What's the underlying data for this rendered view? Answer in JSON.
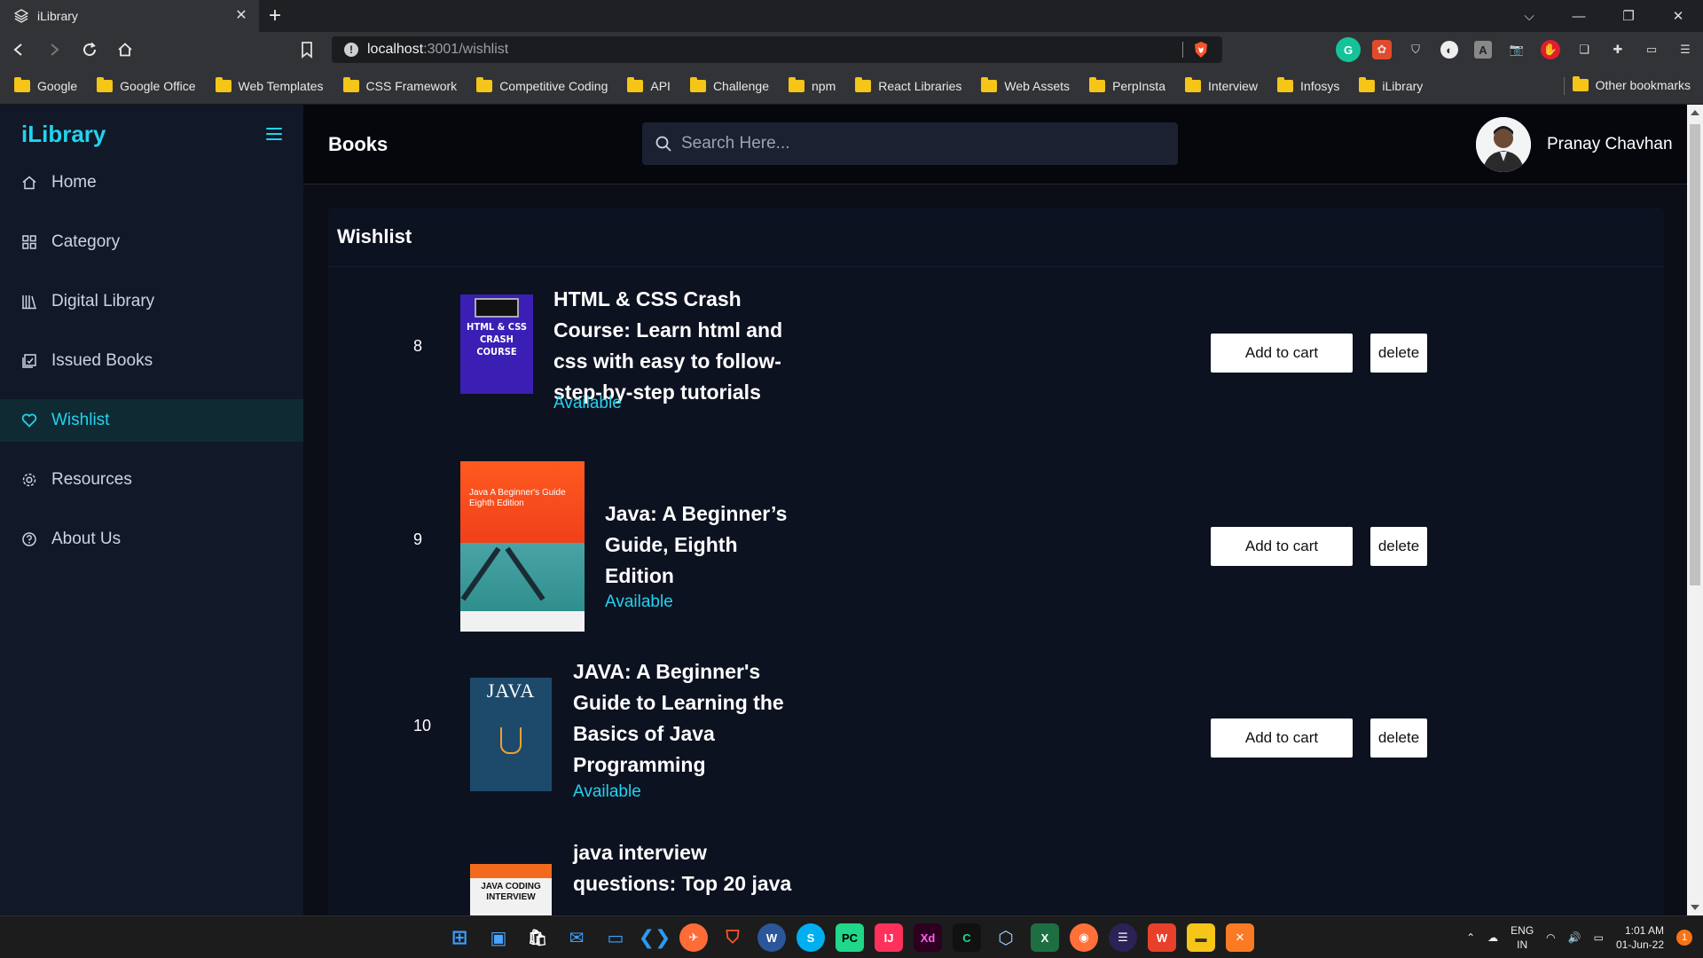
{
  "browser": {
    "tab_title": "iLibrary",
    "url_host": "localhost",
    "url_path": ":3001/wishlist",
    "bookmarks": [
      "Google",
      "Google Office",
      "Web Templates",
      "CSS Framework",
      "Competitive Coding",
      "API",
      "Challenge",
      "npm",
      "React Libraries",
      "Web Assets",
      "PerpInsta",
      "Interview",
      "Infosys",
      "iLibrary"
    ],
    "other_bookmarks": "Other bookmarks"
  },
  "sidebar": {
    "brand": "iLibrary",
    "items": [
      {
        "label": "Home",
        "icon": "home-icon",
        "active": false
      },
      {
        "label": "Category",
        "icon": "grid-icon",
        "active": false
      },
      {
        "label": "Digital Library",
        "icon": "library-icon",
        "active": false
      },
      {
        "label": "Issued Books",
        "icon": "issued-icon",
        "active": false
      },
      {
        "label": "Wishlist",
        "icon": "heart-icon",
        "active": true
      },
      {
        "label": "Resources",
        "icon": "gear-icon",
        "active": false
      },
      {
        "label": "About Us",
        "icon": "help-icon",
        "active": false
      }
    ]
  },
  "header": {
    "title": "Books",
    "search_placeholder": "Search Here...",
    "user_name": "Pranay Chavhan"
  },
  "wishlist": {
    "title": "Wishlist",
    "add_label": "Add to cart",
    "delete_label": "delete",
    "books": [
      {
        "num": "8",
        "title": "HTML & CSS Crash Course: Learn html and css with easy to follow-step-by-step tutorials",
        "status": "Available",
        "cover_text": "HTML & CSS CRASH COURSE"
      },
      {
        "num": "9",
        "title": "Java: A Beginner’s Guide, Eighth Edition",
        "status": "Available",
        "cover_text": "Java A Beginner's Guide Eighth Edition"
      },
      {
        "num": "10",
        "title": "JAVA: A Beginner's Guide to Learning the Basics of Java Programming",
        "status": "Available",
        "cover_text": "JAVA"
      },
      {
        "num": "",
        "title": "java interview questions: Top 20 java",
        "status": "",
        "cover_text": "JAVA CODING INTERVIEW"
      }
    ]
  },
  "colors": {
    "accent": "#22d3ee",
    "sidebar_bg": "#111827",
    "header_bg": "#05070d",
    "panel_bg": "#0d1221"
  },
  "taskbar": {
    "lang_top": "ENG",
    "lang_bottom": "IN",
    "time": "1:01 AM",
    "date": "01-Jun-22",
    "notifications": "1"
  }
}
